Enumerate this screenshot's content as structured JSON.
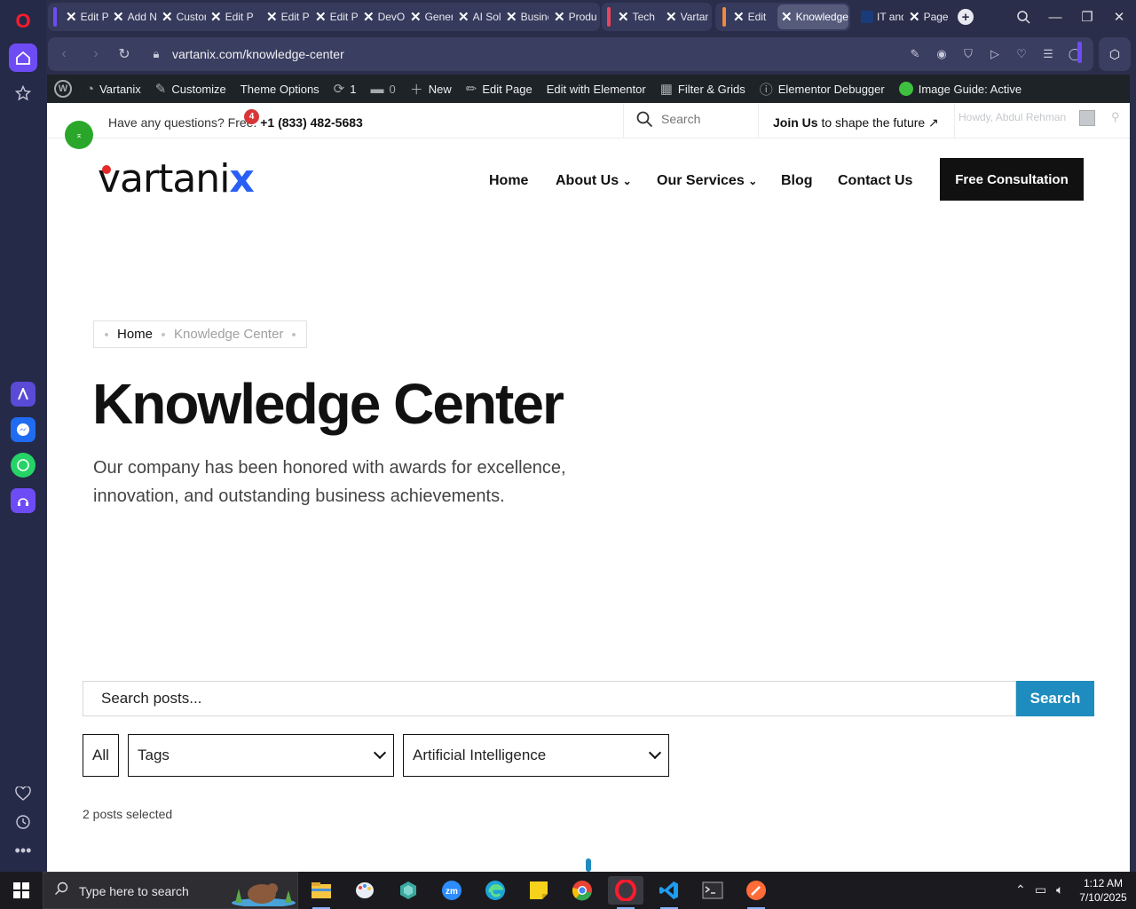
{
  "browser": {
    "tabs": [
      {
        "label": "Edit Post"
      },
      {
        "label": "Add New"
      },
      {
        "label": "Customize"
      },
      {
        "label": "Edit Page"
      },
      {
        "label": "Edit Page"
      },
      {
        "label": "Edit Page"
      },
      {
        "label": "DevOps"
      },
      {
        "label": "Generative"
      },
      {
        "label": "AI Solutions"
      },
      {
        "label": "Business"
      },
      {
        "label": "Products"
      },
      {
        "label": "Tech"
      },
      {
        "label": "Vartanix"
      },
      {
        "label": "Edit"
      },
      {
        "label": "Knowledge Center"
      },
      {
        "label": "IT and"
      },
      {
        "label": "Page"
      }
    ],
    "url": "vartanix.com/knowledge-center",
    "accent_colors": {
      "group1": "#6e4cf5",
      "group2": "#e8455e",
      "group3": "#f08a3c",
      "active_tab": "#565b7c"
    }
  },
  "wp_admin_bar": {
    "site_name": "Vartanix",
    "customize": "Customize",
    "theme_options": "Theme Options",
    "updates_count": "1",
    "comments_count": "0",
    "new": "New",
    "edit_page": "Edit Page",
    "edit_with_elementor": "Edit with Elementor",
    "filter_grids": "Filter & Grids",
    "elementor_debugger": "Elementor Debugger",
    "image_guide": "Image Guide: Active"
  },
  "top_bar": {
    "question": "Have any questions? Free:",
    "phone": "+1 (833) 482-5683",
    "notification_count": "4",
    "search_placeholder": "Search",
    "join_bold": "Join Us",
    "join_rest": "to shape the future",
    "howdy": "Howdy, Abdul Rehman"
  },
  "header": {
    "logo_main": "vartani",
    "logo_x": "x",
    "nav": [
      {
        "label": "Home"
      },
      {
        "label": "About Us"
      },
      {
        "label": "Our Services"
      },
      {
        "label": "Blog"
      },
      {
        "label": "Contact Us"
      }
    ],
    "cta": "Free Consultation"
  },
  "hero": {
    "breadcrumb_home": "Home",
    "breadcrumb_current": "Knowledge Center",
    "title": "Knowledge Center",
    "description": "Our company has been honored with awards for excellence, innovation, and outstanding business achievements."
  },
  "filters": {
    "search_placeholder": "Search posts...",
    "search_button": "Search",
    "all_label": "All",
    "tags_label": "Tags",
    "category_selected": "Artificial Intelligence",
    "posts_selected": "2 posts selected"
  },
  "taskbar": {
    "search_placeholder": "Type here to search",
    "time": "1:12 AM",
    "date": "7/10/2025"
  }
}
